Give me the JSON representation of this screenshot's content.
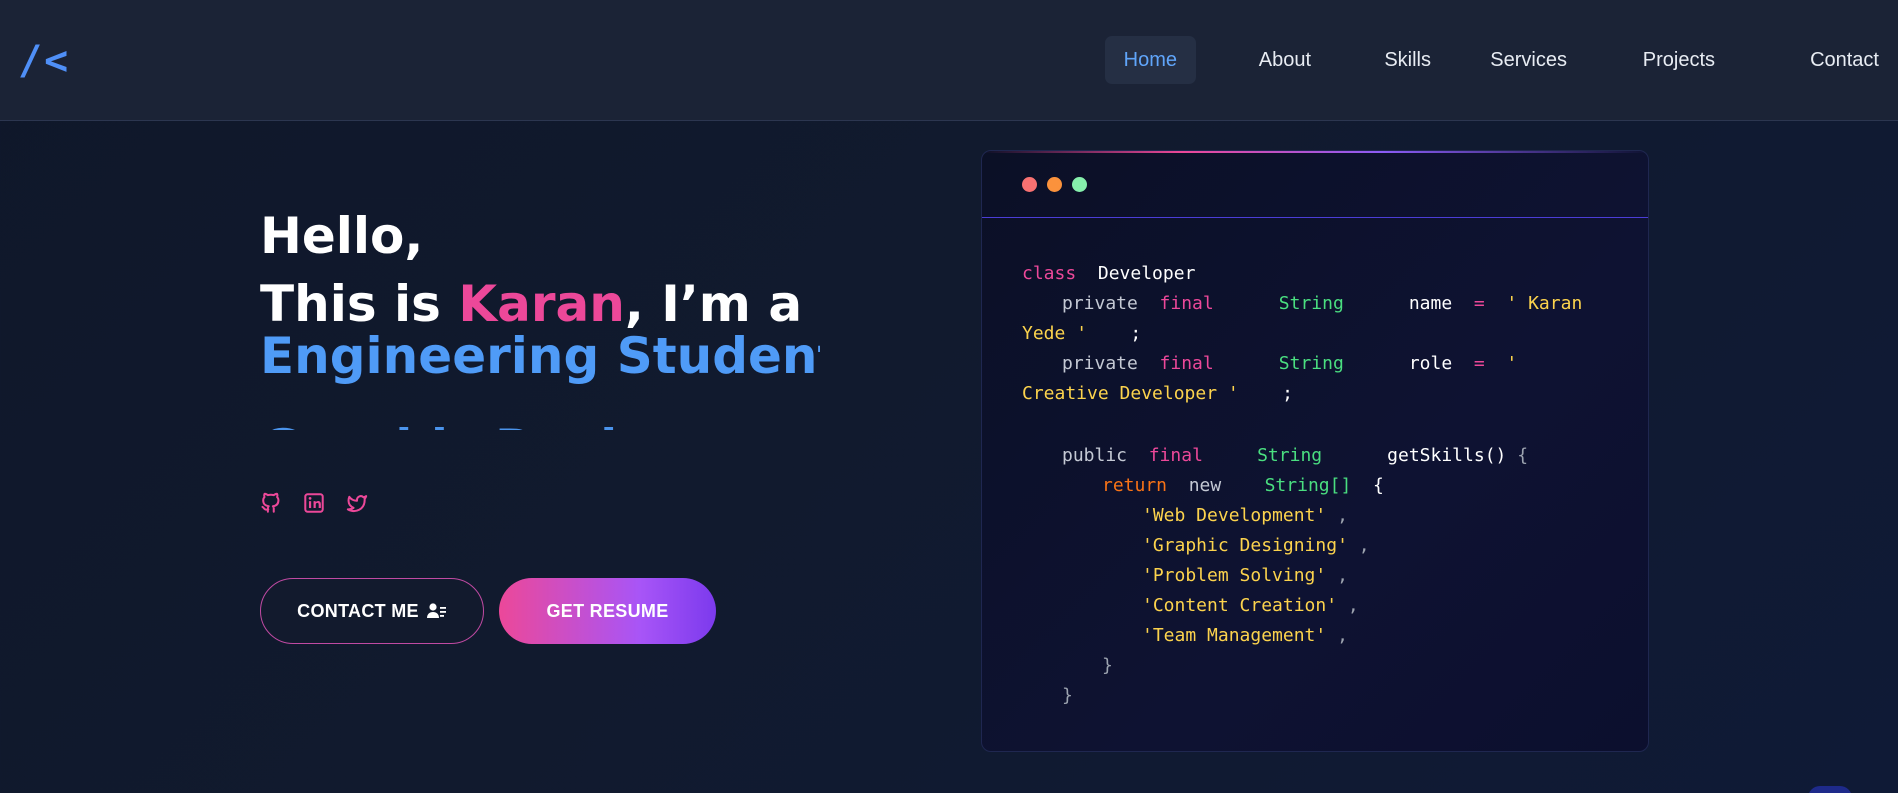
{
  "header": {
    "logo": "/<",
    "nav": [
      {
        "label": "Home",
        "active": true
      },
      {
        "label": "About",
        "active": false
      },
      {
        "label": "Skills",
        "active": false
      },
      {
        "label": "Services",
        "active": false
      },
      {
        "label": "Projects",
        "active": false
      },
      {
        "label": "Contact",
        "active": false
      }
    ]
  },
  "hero": {
    "greeting": "Hello,",
    "intro_prefix": "This is ",
    "name": "Karan",
    "intro_suffix": ", I’m a",
    "role_current": "Engineering Student",
    "role_next": "Graphic Designer",
    "socials": [
      {
        "icon": "github-icon"
      },
      {
        "icon": "linkedin-icon"
      },
      {
        "icon": "twitter-icon"
      }
    ],
    "contact_label": "CONTACT ME",
    "resume_label": "GET RESUME"
  },
  "code_window": {
    "dots": [
      "#f87171",
      "#fb923c",
      "#86efac"
    ],
    "line1_kw": "class",
    "line1_name": "Developer",
    "name_mod": "private",
    "name_final": "final",
    "name_type": "String",
    "name_var": "name",
    "name_eq": "=",
    "name_q": "'",
    "name_val1": "Karan",
    "name_val2": "Yede",
    "name_q2": "'",
    "semi": ";",
    "role_mod": "private",
    "role_final": "final",
    "role_type": "String",
    "role_var": "role",
    "role_eq": "=",
    "role_q": "'",
    "role_val": "Creative Developer",
    "role_q2": "'",
    "role_semi": ";",
    "fn_mod": "public",
    "fn_final": "final",
    "fn_type": "String",
    "fn_name": "getSkills()",
    "fn_brace": "{",
    "ret_kw": "return",
    "ret_new": "new",
    "ret_type": "String[]",
    "ret_brace": "{",
    "skills": [
      "'Web Development'",
      "'Graphic Designing'",
      "'Problem Solving'",
      "'Content Creation'",
      "'Team Management'"
    ],
    "comma": ",",
    "close1": "}",
    "close2": "}"
  }
}
